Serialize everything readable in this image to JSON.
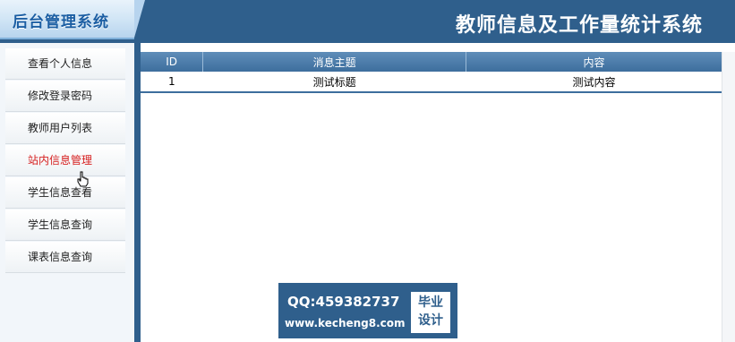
{
  "header": {
    "logo_text": "后台管理系统",
    "title": "教师信息及工作量统计系统"
  },
  "sidebar": {
    "items": [
      {
        "label": "查看个人信息"
      },
      {
        "label": "修改登录密码"
      },
      {
        "label": "教师用户列表"
      },
      {
        "label": "站内信息管理",
        "active": true
      },
      {
        "label": "学生信息查看"
      },
      {
        "label": "学生信息查询"
      },
      {
        "label": "课表信息查询"
      }
    ]
  },
  "table": {
    "headers": [
      "ID",
      "消息主题",
      "内容"
    ],
    "rows": [
      {
        "id": "1",
        "subject": "测试标题",
        "content": "测试内容"
      }
    ]
  },
  "watermark": {
    "qq": "QQ:459382737",
    "url": "www.kecheng8.com",
    "badge_line1": "毕业",
    "badge_line2": "设计"
  },
  "colors": {
    "header_bg": "#2f5f8c",
    "table_header_bg": "#3d6e9d",
    "active_menu": "#d62020"
  }
}
